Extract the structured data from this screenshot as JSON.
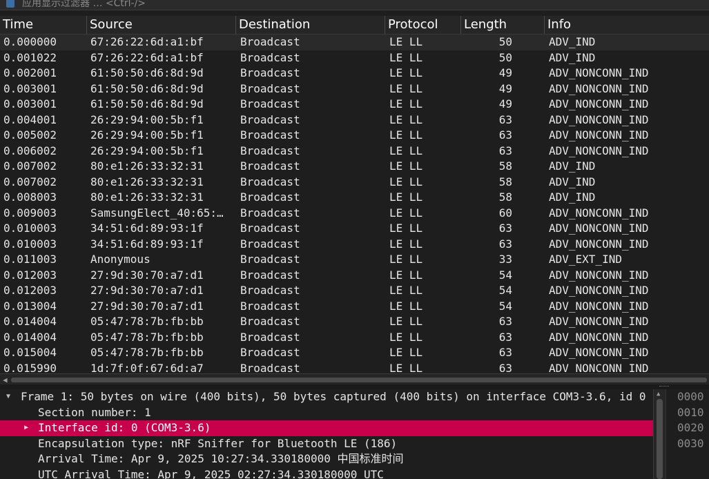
{
  "filter_bar": {
    "placeholder": "应用显示过滤器 … <Ctrl-/>"
  },
  "columns": [
    "Time",
    "Source",
    "Destination",
    "Protocol",
    "Length",
    "Info"
  ],
  "packets": [
    {
      "time": "0.000000",
      "source": "67:26:22:6d:a1:bf",
      "destination": "Broadcast",
      "protocol": "LE LL",
      "length": "50",
      "info": "ADV_IND"
    },
    {
      "time": "0.001022",
      "source": "67:26:22:6d:a1:bf",
      "destination": "Broadcast",
      "protocol": "LE LL",
      "length": "50",
      "info": "ADV_IND"
    },
    {
      "time": "0.002001",
      "source": "61:50:50:d6:8d:9d",
      "destination": "Broadcast",
      "protocol": "LE LL",
      "length": "49",
      "info": "ADV_NONCONN_IND"
    },
    {
      "time": "0.003001",
      "source": "61:50:50:d6:8d:9d",
      "destination": "Broadcast",
      "protocol": "LE LL",
      "length": "49",
      "info": "ADV_NONCONN_IND"
    },
    {
      "time": "0.003001",
      "source": "61:50:50:d6:8d:9d",
      "destination": "Broadcast",
      "protocol": "LE LL",
      "length": "49",
      "info": "ADV_NONCONN_IND"
    },
    {
      "time": "0.004001",
      "source": "26:29:94:00:5b:f1",
      "destination": "Broadcast",
      "protocol": "LE LL",
      "length": "63",
      "info": "ADV_NONCONN_IND"
    },
    {
      "time": "0.005002",
      "source": "26:29:94:00:5b:f1",
      "destination": "Broadcast",
      "protocol": "LE LL",
      "length": "63",
      "info": "ADV_NONCONN_IND"
    },
    {
      "time": "0.006002",
      "source": "26:29:94:00:5b:f1",
      "destination": "Broadcast",
      "protocol": "LE LL",
      "length": "63",
      "info": "ADV_NONCONN_IND"
    },
    {
      "time": "0.007002",
      "source": "80:e1:26:33:32:31",
      "destination": "Broadcast",
      "protocol": "LE LL",
      "length": "58",
      "info": "ADV_IND"
    },
    {
      "time": "0.007002",
      "source": "80:e1:26:33:32:31",
      "destination": "Broadcast",
      "protocol": "LE LL",
      "length": "58",
      "info": "ADV_IND"
    },
    {
      "time": "0.008003",
      "source": "80:e1:26:33:32:31",
      "destination": "Broadcast",
      "protocol": "LE LL",
      "length": "58",
      "info": "ADV_IND"
    },
    {
      "time": "0.009003",
      "source": "SamsungElect_40:65:…",
      "destination": "Broadcast",
      "protocol": "LE LL",
      "length": "60",
      "info": "ADV_NONCONN_IND"
    },
    {
      "time": "0.010003",
      "source": "34:51:6d:89:93:1f",
      "destination": "Broadcast",
      "protocol": "LE LL",
      "length": "63",
      "info": "ADV_NONCONN_IND"
    },
    {
      "time": "0.010003",
      "source": "34:51:6d:89:93:1f",
      "destination": "Broadcast",
      "protocol": "LE LL",
      "length": "63",
      "info": "ADV_NONCONN_IND"
    },
    {
      "time": "0.011003",
      "source": "Anonymous",
      "destination": "Broadcast",
      "protocol": "LE LL",
      "length": "33",
      "info": "ADV_EXT_IND"
    },
    {
      "time": "0.012003",
      "source": "27:9d:30:70:a7:d1",
      "destination": "Broadcast",
      "protocol": "LE LL",
      "length": "54",
      "info": "ADV_NONCONN_IND"
    },
    {
      "time": "0.012003",
      "source": "27:9d:30:70:a7:d1",
      "destination": "Broadcast",
      "protocol": "LE LL",
      "length": "54",
      "info": "ADV_NONCONN_IND"
    },
    {
      "time": "0.013004",
      "source": "27:9d:30:70:a7:d1",
      "destination": "Broadcast",
      "protocol": "LE LL",
      "length": "54",
      "info": "ADV_NONCONN_IND"
    },
    {
      "time": "0.014004",
      "source": "05:47:78:7b:fb:bb",
      "destination": "Broadcast",
      "protocol": "LE LL",
      "length": "63",
      "info": "ADV_NONCONN_IND"
    },
    {
      "time": "0.014004",
      "source": "05:47:78:7b:fb:bb",
      "destination": "Broadcast",
      "protocol": "LE LL",
      "length": "63",
      "info": "ADV_NONCONN_IND"
    },
    {
      "time": "0.015004",
      "source": "05:47:78:7b:fb:bb",
      "destination": "Broadcast",
      "protocol": "LE LL",
      "length": "63",
      "info": "ADV_NONCONN_IND"
    },
    {
      "time": "0.015990",
      "source": "1d:7f:0f:67:6d:a7",
      "destination": "Broadcast",
      "protocol": "LE LL",
      "length": "63",
      "info": "ADV_NONCONN_IND"
    }
  ],
  "details": {
    "frame": "Frame 1: 50 bytes on wire (400 bits), 50 bytes captured (400 bits) on interface COM3-3.6, id 0",
    "section": "Section number: 1",
    "interface": "Interface id: 0 (COM3-3.6)",
    "encapsulation": "Encapsulation type: nRF Sniffer for Bluetooth LE (186)",
    "arrival": "Arrival Time: Apr  9, 2025 10:27:34.330180000 中国标准时间",
    "utc_arrival": "UTC Arrival Time: Apr  9, 2025 02:27:34.330180000 UTC"
  },
  "bytes_offsets": [
    "0000",
    "0010",
    "0020",
    "0030"
  ],
  "colors": {
    "highlight": "#c8004b",
    "background": "#1e1e1e"
  }
}
